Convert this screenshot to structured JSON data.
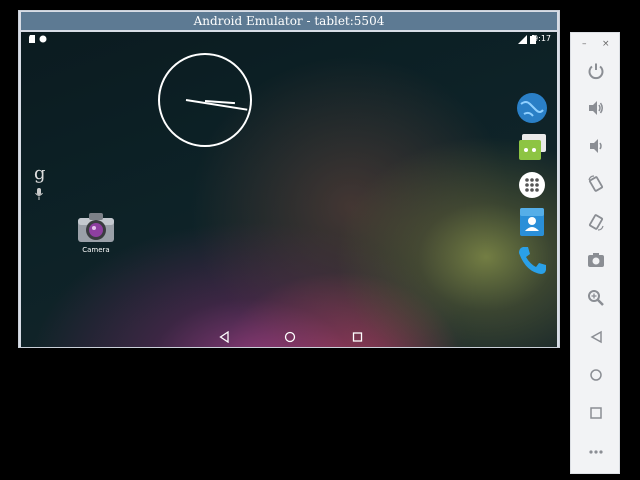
{
  "window": {
    "title": "Android Emulator - tablet:5504"
  },
  "statusbar": {
    "time": "9:17"
  },
  "homescreen": {
    "google_search_glyph": "g",
    "apps": [
      {
        "label": "Camera",
        "icon": "camera-icon"
      }
    ],
    "dock_icons": [
      "browser-globe-icon",
      "messaging-icon",
      "app-drawer-icon",
      "contacts-icon",
      "phone-icon"
    ]
  },
  "navbar": {
    "buttons": [
      "back-icon",
      "home-icon",
      "recents-icon"
    ]
  },
  "side_panel": {
    "minimize": "–",
    "close": "×",
    "tools": [
      "power-icon",
      "volume-up-icon",
      "volume-down-icon",
      "rotate-left-icon",
      "rotate-right-icon",
      "screenshot-icon",
      "zoom-icon",
      "back-icon",
      "home-icon",
      "overview-icon",
      "more-icon"
    ]
  },
  "colors": {
    "titlebar": "#5d7a93",
    "panel_icon": "#8b8e94",
    "android_green": "#8dc443",
    "contacts_blue": "#2a8fd8"
  }
}
